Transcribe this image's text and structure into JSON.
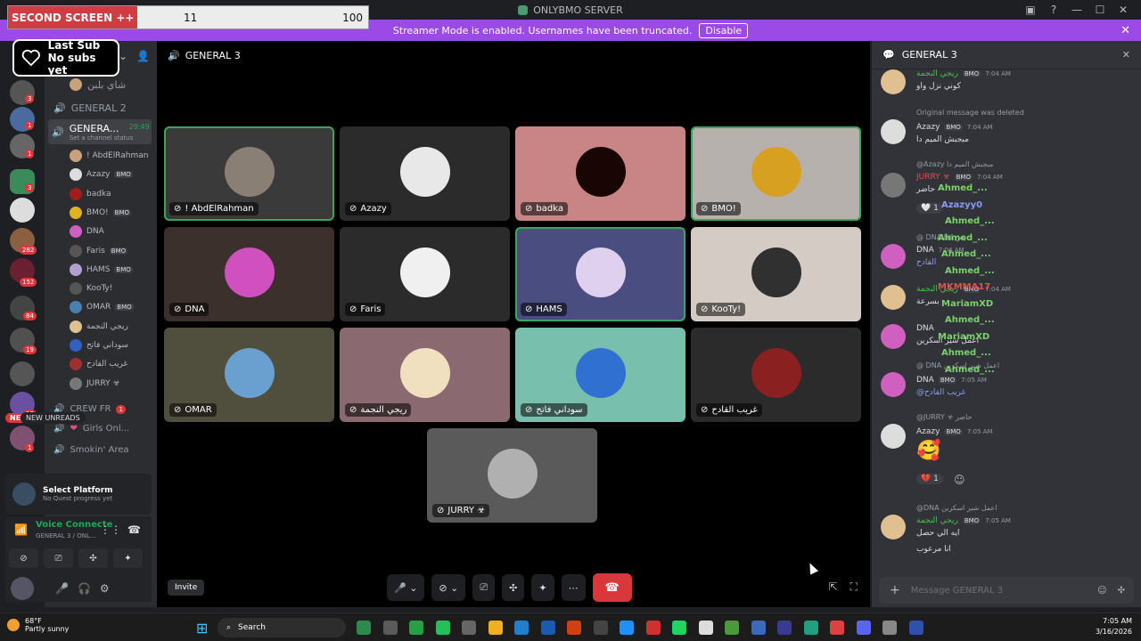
{
  "window": {
    "title": "ONLYBMO SERVER",
    "controls": [
      "—",
      "☐",
      "✕"
    ]
  },
  "overlay": {
    "label": "SECOND SCREEN ++",
    "value1": "11",
    "value2": "100"
  },
  "banner": {
    "text": "Streamer Mode is enabled. Usernames have been truncated.",
    "button": "Disable"
  },
  "lastsub": {
    "title": "Last Sub",
    "subtitle": "No subs yet"
  },
  "guild_badges": [
    "3",
    "1",
    "1",
    "3",
    "282",
    "152",
    "84",
    "19",
    "13",
    "1"
  ],
  "sidebar": {
    "top_item": "شاي بلبن",
    "general2": "GENERAL 2",
    "active_channel": {
      "name": "GENERA...",
      "time": "29:49",
      "status": "Set a channel status"
    },
    "voice_users": [
      {
        "name": "! AbdElRahman",
        "bmo": "",
        "color": "#c9a27c"
      },
      {
        "name": "Azazy",
        "bmo": "BMO",
        "color": "#ddd"
      },
      {
        "name": "badka",
        "bmo": "",
        "color": "#a21c1c"
      },
      {
        "name": "BMO!",
        "bmo": "BMO",
        "color": "#e0b020"
      },
      {
        "name": "DNA",
        "bmo": "",
        "color": "#d060c0"
      },
      {
        "name": "Faris",
        "bmo": "BMO",
        "color": "#555"
      },
      {
        "name": "HAMS",
        "bmo": "BMO",
        "color": "#b0a0d0"
      },
      {
        "name": "KooTy!",
        "bmo": "",
        "color": "#555"
      },
      {
        "name": "OMAR",
        "bmo": "BMO",
        "color": "#4a80b0"
      },
      {
        "name": "ريجي النجمة",
        "bmo": "",
        "color": "#e0c090"
      },
      {
        "name": "سوداني فاتح",
        "bmo": "",
        "color": "#3060c0"
      },
      {
        "name": "غريب القادح",
        "bmo": "",
        "color": "#a03030"
      },
      {
        "name": "JURRY ☣",
        "bmo": "",
        "color": "#777"
      }
    ],
    "crew": "CREW FR",
    "crew_badge": "1",
    "girls": "Girls Onl...",
    "smokin": "Smokin' Area",
    "new_unreads": "NEW UNREADS",
    "new_badge": "NEW"
  },
  "platform": {
    "title": "Select Platform",
    "sub": "No Quest progress yet"
  },
  "voice": {
    "status": "Voice Connecte",
    "channel": "GENERAL 3 / ONL..."
  },
  "main": {
    "channel": "GENERAL 3",
    "tiles": [
      {
        "name": "! AbdElRahman",
        "bg": "#3a3a3a",
        "ring": "#8a7f74",
        "speaking": true
      },
      {
        "name": "Azazy",
        "bg": "#2b2b2b",
        "ring": "#e8e8e8",
        "speaking": false
      },
      {
        "name": "badka",
        "bg": "#c98585",
        "ring": "#1a0505",
        "speaking": false
      },
      {
        "name": "BMO!",
        "bg": "#b7b1ae",
        "ring": "#d8a020",
        "speaking": true
      },
      {
        "name": "DNA",
        "bg": "#3b302b",
        "ring": "#d050c0",
        "speaking": false
      },
      {
        "name": "Faris",
        "bg": "#2b2b2b",
        "ring": "#f0f0f0",
        "speaking": false
      },
      {
        "name": "HAMS",
        "bg": "#4a4d80",
        "ring": "#e0d0f0",
        "speaking": true
      },
      {
        "name": "KooTy!",
        "bg": "#d4ccc4",
        "ring": "#303030",
        "speaking": false
      },
      {
        "name": "OMAR",
        "bg": "#504f3e",
        "ring": "#6aa0d0",
        "speaking": false
      },
      {
        "name": "ريجي النجمة",
        "bg": "#8a6a70",
        "ring": "#f0e0c0",
        "speaking": false
      },
      {
        "name": "سوداني فاتح",
        "bg": "#78bfae",
        "ring": "#3070d0",
        "speaking": false
      },
      {
        "name": "غريب القادح",
        "bg": "#2b2b2b",
        "ring": "#8a2020",
        "speaking": false
      },
      {
        "name": "JURRY ☣",
        "bg": "#5a5a5a",
        "ring": "#b0b0b0",
        "speaking": false
      }
    ],
    "invite": "Invite"
  },
  "chat": {
    "title": "GENERAL 3",
    "messages": [
      {
        "name": "ريجي النجمة",
        "color": "#4ac04a",
        "bmo": "BMO",
        "time": "7:04 AM",
        "text": "كوني نزل واو"
      },
      {
        "reply": "Original message was deleted",
        "name": "Azazy",
        "color": "#dbdee1",
        "bmo": "BMO",
        "time": "7:04 AM",
        "text": "مبجبش الميم دا"
      },
      {
        "reply": "@Azazy مبجبش الميم دا",
        "name": "JURRY ☣",
        "color": "#e05050",
        "bmo": "BMO",
        "time": "7:04 AM",
        "text": "حاضر"
      },
      {
        "reply": "@ DNA بص كدا",
        "name": "DNA",
        "color": "#dbdee1",
        "bmo": "",
        "time": "7:04 AM",
        "text": "القادح"
      },
      {
        "name": "ريجي النجمة",
        "color": "#4ac04a",
        "bmo": "BMO",
        "time": "7:04 AM",
        "text": "بسرعة"
      },
      {
        "name": "DNA",
        "color": "#dbdee1",
        "bmo": "",
        "time": "",
        "text": "اعمل شير اسكرين"
      },
      {
        "reply": "@ DNA اعمل شير اسكرين",
        "name": "DNA",
        "color": "#dbdee1",
        "bmo": "BMO",
        "time": "7:05 AM",
        "text": "@غريب القادح"
      },
      {
        "reply": "@JURRY ☣ حاضر",
        "name": "Azazy",
        "color": "#dbdee1",
        "bmo": "BMO",
        "time": "7:05 AM",
        "text": "🥰"
      },
      {
        "reply": "@DNA اعمل شير اسكرين",
        "name": "ريجي النجمة",
        "color": "#4ac04a",
        "bmo": "BMO",
        "time": "7:05 AM",
        "text": "ايه الي حصل"
      },
      {
        "text_only": "انا مرعوب"
      }
    ],
    "spam": [
      "Ahmed_...",
      "Azazyy0",
      "Ahmed_...",
      "Ahmed_...",
      "Ahmed_...",
      "Ahmed_...",
      "MKMMA17",
      "MariamXD",
      "Ahmed_...",
      "MariamXD",
      "Ahmed_...",
      "Ahmed_..."
    ],
    "reactions": [
      {
        "e": "🤍",
        "c": "1"
      },
      {
        "e": "💔",
        "c": "1"
      }
    ],
    "placeholder": "Message GENERAL 3"
  },
  "taskbar": {
    "temp": "68°F",
    "weather": "Partly sunny",
    "search": "Search",
    "time": "7:05 AM",
    "date": "3/16/2026"
  }
}
